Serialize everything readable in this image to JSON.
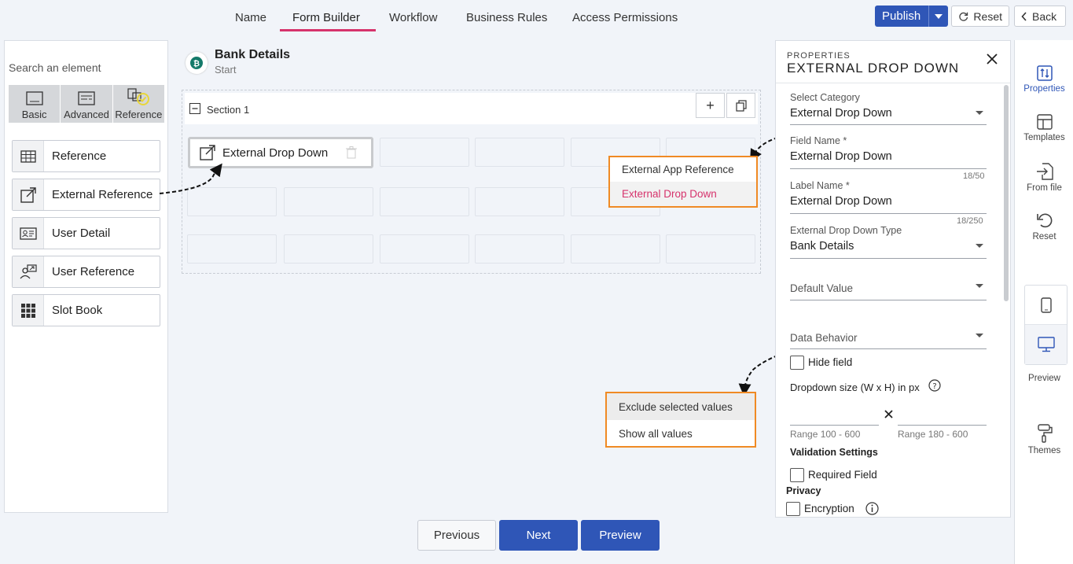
{
  "nav": {
    "tabs": [
      "Name",
      "Form Builder",
      "Workflow",
      "Business Rules",
      "Access Permissions"
    ],
    "publish": "Publish",
    "reset": "Reset",
    "back": "Back"
  },
  "left": {
    "search_label": "Search an element",
    "categories": [
      "Basic",
      "Advanced",
      "Reference"
    ],
    "elements": [
      "Reference",
      "External Reference",
      "User Detail",
      "User Reference",
      "Slot Book"
    ]
  },
  "form": {
    "title": "Bank Details",
    "subtitle": "Start",
    "section_label": "Section 1",
    "placed_element": "External Drop Down"
  },
  "popup_category": {
    "options": [
      "External App Reference",
      "External Drop Down"
    ]
  },
  "popup_behavior": {
    "options": [
      "Exclude selected values",
      "Show all values"
    ]
  },
  "properties": {
    "caption": "PROPERTIES",
    "title": "EXTERNAL DROP DOWN",
    "select_category_label": "Select Category",
    "select_category_value": "External Drop Down",
    "field_name_label": "Field Name *",
    "field_name_value": "External Drop Down",
    "field_name_count": "18/50",
    "label_name_label": "Label Name *",
    "label_name_value": "External Drop Down",
    "label_name_count": "18/250",
    "type_label": "External Drop Down Type",
    "type_value": "Bank Details",
    "default_label": "Default Value",
    "behavior_label": "Data Behavior",
    "hide_field": "Hide field",
    "size_label": "Dropdown size (W x H) in px",
    "range_w": "Range 100 - 600",
    "range_h": "Range 180 - 600",
    "validation_heading": "Validation Settings",
    "required": "Required Field",
    "privacy_heading": "Privacy",
    "encryption": "Encryption"
  },
  "rail": {
    "properties": "Properties",
    "templates": "Templates",
    "from_file": "From file",
    "reset": "Reset",
    "preview": "Preview",
    "themes": "Themes"
  },
  "bottom": {
    "previous": "Previous",
    "next": "Next",
    "preview": "Preview"
  },
  "colors": {
    "primary": "#2f56b7",
    "accent": "#d6336c",
    "highlight": "#f08a24"
  }
}
